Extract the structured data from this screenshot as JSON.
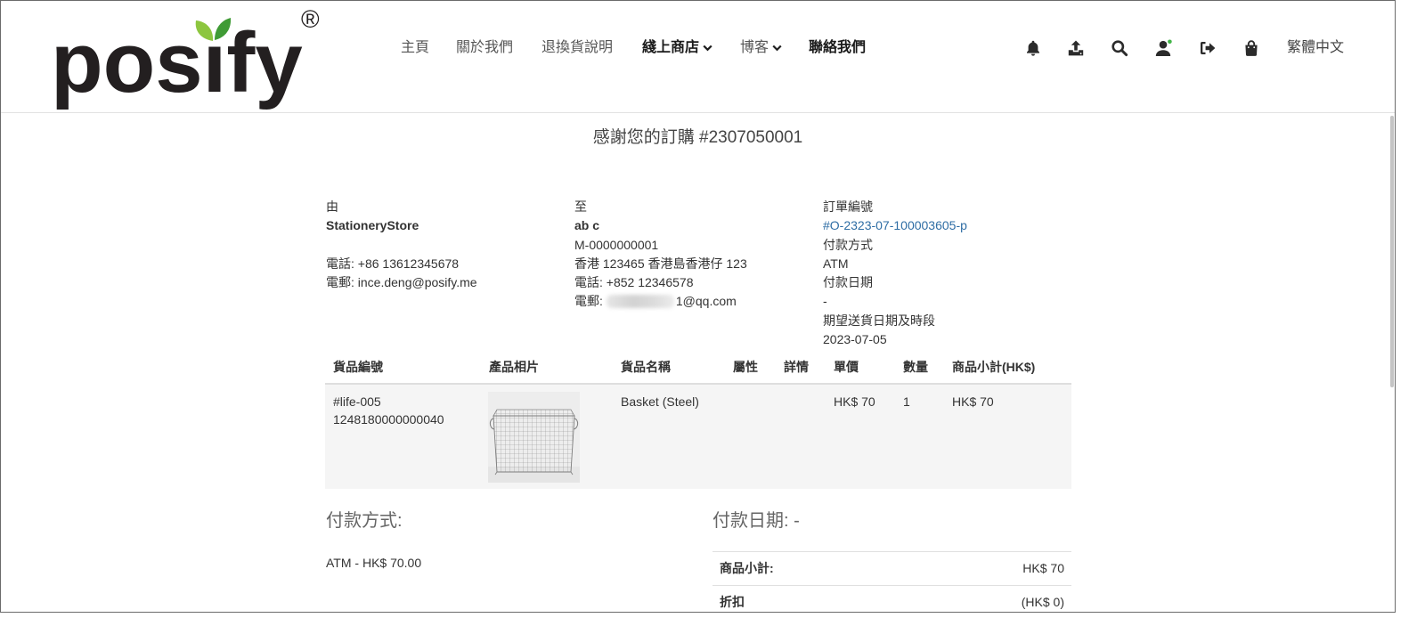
{
  "header": {
    "logo": {
      "text": "posify",
      "mark": "®"
    },
    "nav": [
      {
        "label": "主頁"
      },
      {
        "label": "關於我們"
      },
      {
        "label": "退換貨說明"
      },
      {
        "label": "綫上商店",
        "has_dropdown": true
      },
      {
        "label": "博客",
        "has_dropdown": true
      },
      {
        "label": "聯絡我們"
      }
    ],
    "action_icons": [
      "bell-icon",
      "upload-icon",
      "search-icon",
      "user-icon",
      "sign-out-icon",
      "shopping-bag-icon"
    ],
    "language": "繁體中文"
  },
  "order": {
    "title": "感謝您的訂購 #2307050001",
    "from": {
      "heading": "由",
      "name": "StationeryStore",
      "phone": "電話: +86 13612345678",
      "email": "電郵: ince.deng@posify.me"
    },
    "to": {
      "heading": "至",
      "name": "ab c",
      "member_id": "M-0000000001",
      "address": "香港 123465 香港島香港仔 123",
      "phone": "電話: +852 12346578",
      "email_label": "電郵:",
      "email_suffix": "1@qq.com"
    },
    "info": {
      "order_no_label": "訂單編號",
      "order_no": "#O-2323-07-100003605-p",
      "payment_method_label": "付款方式",
      "payment_method": "ATM",
      "payment_date_label": "付款日期",
      "payment_date": "-",
      "delivery_label": "期望送貨日期及時段",
      "delivery_date": "2023-07-05"
    },
    "items": {
      "columns": [
        "貨品編號",
        "產品相片",
        "貨品名稱",
        "屬性",
        "詳情",
        "單價",
        "數量",
        "商品小計(HK$)"
      ],
      "rows": [
        {
          "sku": "#life-005",
          "barcode": "1248180000000040",
          "name": "Basket (Steel)",
          "unit_price": "HK$ 70",
          "quantity": "1",
          "subtotal": "HK$ 70"
        }
      ]
    },
    "payment": {
      "method_heading": "付款方式:",
      "method_line": "ATM - HK$ 70.00",
      "date_heading": "付款日期: -"
    },
    "totals": [
      {
        "label": "商品小計:",
        "value": "HK$ 70"
      },
      {
        "label": "折扣",
        "value": "(HK$ 0)"
      }
    ]
  },
  "colors": {
    "link": "#2e6da4",
    "leaf_light": "#8dc63f",
    "leaf_dark": "#3f9b35",
    "online_status": "#43b649",
    "text": "#333333"
  }
}
